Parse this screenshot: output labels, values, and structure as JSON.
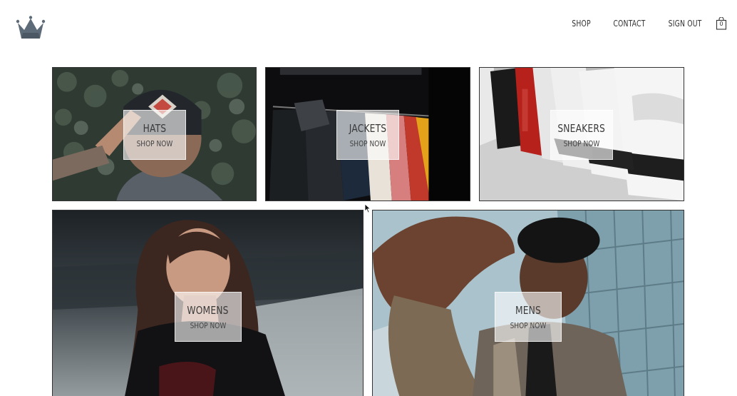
{
  "header": {
    "logo_icon": "crown-icon",
    "nav": [
      "SHOP",
      "CONTACT",
      "SIGN OUT"
    ],
    "cart_icon": "shopping-bag-icon",
    "cart_count": "0"
  },
  "categories": [
    {
      "title": "HATS",
      "cta": "SHOP NOW"
    },
    {
      "title": "JACKETS",
      "cta": "SHOP NOW"
    },
    {
      "title": "SNEAKERS",
      "cta": "SHOP NOW"
    },
    {
      "title": "WOMENS",
      "cta": "SHOP NOW"
    },
    {
      "title": "MENS",
      "cta": "SHOP NOW"
    }
  ],
  "colors": {
    "text": "#333333",
    "border": "#333333",
    "label_overlay": "#ffffffa0"
  }
}
